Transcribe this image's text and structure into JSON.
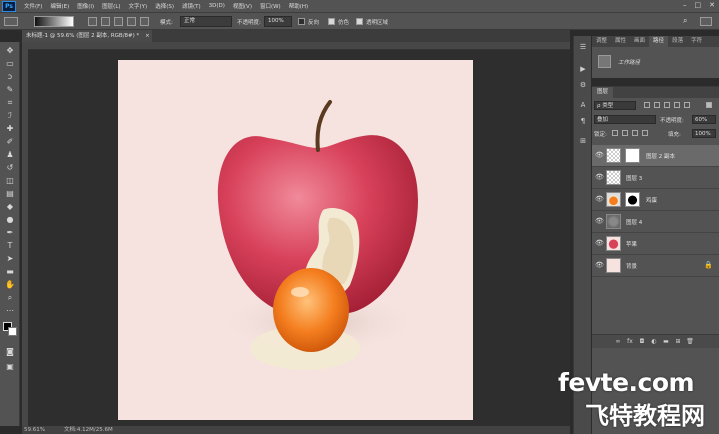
{
  "app": {
    "logo": "Ps"
  },
  "menu": [
    "文件(F)",
    "编辑(E)",
    "图像(I)",
    "图层(L)",
    "文字(Y)",
    "选择(S)",
    "滤镜(T)",
    "3D(D)",
    "视图(V)",
    "窗口(W)",
    "帮助(H)"
  ],
  "window_controls": [
    "–",
    "□",
    "✕"
  ],
  "options": {
    "mode_label": "模式:",
    "mode_value": "正常",
    "opacity_label": "不透明度:",
    "opacity_value": "100%",
    "reverse_label": "反向",
    "dither_label": "仿色",
    "transparency_label": "透明区域",
    "reverse_checked": false,
    "dither_checked": true,
    "transparency_checked": true
  },
  "document": {
    "tab_title": "未标题-1 @ 59.6% (图层 2 副本, RGB/8#) *",
    "tab_close": "×"
  },
  "status": {
    "zoom": "59.61%",
    "doc_info": "文档:4.12M/25.6M"
  },
  "history_panel": {
    "tabs": [
      "调整",
      "属性",
      "画面",
      "路径",
      "段落",
      "字符"
    ],
    "active_tab": "路径",
    "item_label": "工作路径"
  },
  "layers_panel": {
    "title": "图层",
    "filter_value": "ρ 类型",
    "blend_value": "叠加",
    "opacity_label": "不透明度:",
    "opacity_value": "60%",
    "lock_label": "锁定:",
    "fill_label": "填充:",
    "fill_value": "100%",
    "layers": [
      {
        "name": "图层 2 副本",
        "selected": true,
        "has_mask": true,
        "thumb": "checker"
      },
      {
        "name": "图层 3",
        "selected": false,
        "has_mask": false,
        "thumb": "checker"
      },
      {
        "name": "鸡蛋",
        "selected": false,
        "has_mask": true,
        "thumb": "egg"
      },
      {
        "name": "图层 4",
        "selected": false,
        "has_mask": false,
        "thumb": "gray"
      },
      {
        "name": "苹果",
        "selected": false,
        "has_mask": false,
        "thumb": "apple"
      },
      {
        "name": "背景",
        "selected": false,
        "has_mask": false,
        "thumb": "pink",
        "locked": true
      }
    ]
  },
  "colors": {
    "canvas_bg": "#f6e3e0",
    "apple_red": "#d8415a",
    "yolk_orange": "#f47e1f",
    "panel_bg": "#535353",
    "workspace_bg": "#2e2e2e"
  },
  "watermark": {
    "line1": "fevte.com",
    "line2": "飞特教程网"
  }
}
